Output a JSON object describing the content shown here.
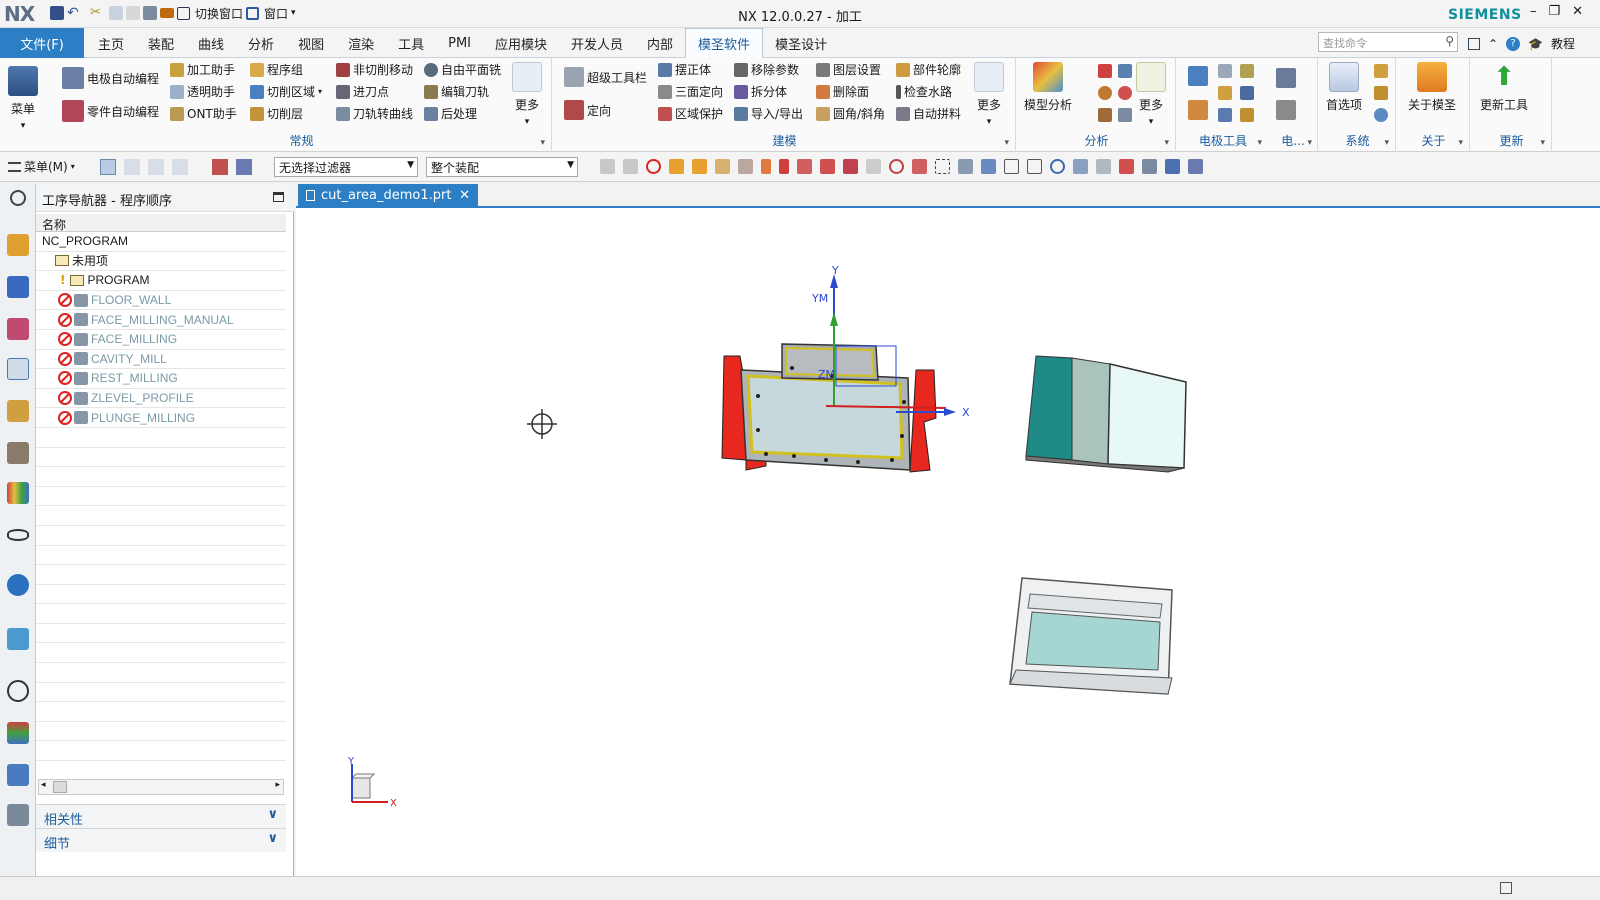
{
  "app": {
    "logo": "NX",
    "title": "NX 12.0.0.27 - 加工",
    "brand": "SIEMENS",
    "switch_window_label": "切换窗口",
    "window_label": "窗口",
    "window_controls": [
      "–",
      "❐",
      "✕"
    ]
  },
  "ribbon_tabs": {
    "file": "文件(F)",
    "tabs": [
      "主页",
      "装配",
      "曲线",
      "分析",
      "视图",
      "渲染",
      "工具",
      "PMI",
      "应用模块",
      "开发人员",
      "内部",
      "模圣软件",
      "模圣设计"
    ],
    "active_index": 11,
    "search_placeholder": "查找命令",
    "help_label": "教程"
  },
  "ribbon": {
    "menu_label": "菜单",
    "changgui": {
      "group_label": "常规",
      "items": [
        "电极自动编程",
        "零件自动编程",
        "加工助手",
        "透明助手",
        "ONT助手",
        "程序组",
        "切削区域",
        "切削层",
        "非切削移动",
        "进刀点",
        "刀轨转曲线",
        "自由平面铣",
        "编辑刀轨",
        "后处理"
      ],
      "more_label": "更多"
    },
    "jianmo": {
      "group_label": "建模",
      "items": [
        "超级工具栏",
        "定向",
        "摆正体",
        "三面定向",
        "区域保护",
        "移除参数",
        "拆分体",
        "导入/导出",
        "图层设置",
        "删除面",
        "圆角/斜角",
        "部件轮廓",
        "检查水路",
        "自动拼料"
      ],
      "more_label": "更多"
    },
    "fenxi": {
      "group_label": "分析",
      "big_label": "模型分析",
      "more_label": "更多"
    },
    "dianji": {
      "group_label": "电极工具",
      "group2_label": "电..."
    },
    "xitong": {
      "group_label": "系统",
      "big_label": "首选项"
    },
    "guanyu": {
      "group_label": "关于",
      "big_label": "关于模圣"
    },
    "gengxin": {
      "group_label": "更新",
      "big_label": "更新工具"
    }
  },
  "command_bar": {
    "menu_label": "菜单(M)",
    "filter_value": "无选择过滤器",
    "assembly_value": "整个装配"
  },
  "navigator": {
    "title": "工序导航器 - 程序顺序",
    "column_name": "名称",
    "root": "NC_PROGRAM",
    "unused": "未用项",
    "program": "PROGRAM",
    "operations": [
      "FLOOR_WALL",
      "FACE_MILLING_MANUAL",
      "FACE_MILLING",
      "CAVITY_MILL",
      "REST_MILLING",
      "ZLEVEL_PROFILE",
      "PLUNGE_MILLING"
    ],
    "dependencies_label": "相关性",
    "details_label": "细节"
  },
  "viewport": {
    "file_tab": "cut_area_demo1.prt",
    "axis_labels": {
      "y": "Y",
      "ym": "YM",
      "zm": "ZM",
      "x": "X"
    },
    "triad": {
      "y": "Y",
      "x": "X"
    }
  },
  "colors": {
    "accent": "#2c7fc4",
    "clamp_red": "#e8281e",
    "part_fill": "#c7d8dc",
    "teal_block": "#1f8a85"
  }
}
